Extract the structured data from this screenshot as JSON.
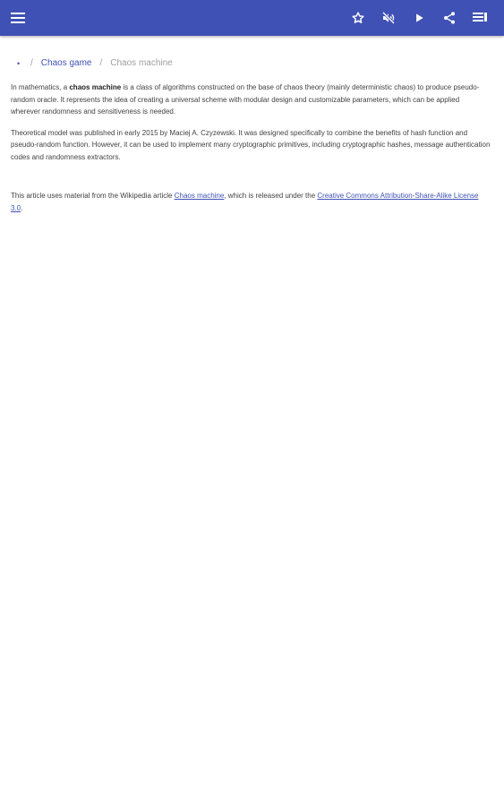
{
  "breadcrumb": {
    "home_symbol": "•",
    "separator": "/",
    "parent": "Chaos game",
    "current": "Chaos machine"
  },
  "article": {
    "p1_before": "In mathematics, a ",
    "p1_bold": "chaos machine",
    "p1_after": " is a class of algorithms constructed on the base of chaos theory (mainly deterministic chaos) to produce pseudo-random oracle. It represents the idea of creating a universal scheme with modular design and customizable parameters, which can be applied wherever randomness and sensitiveness is needed.",
    "p2": "Theoretical model was published in early 2015 by Maciej A. Czyzewski. It was designed specifically to combine the benefits of hash function and pseudo-random function. However, it can be used to implement many cryptographic primitives, including cryptographic hashes, message authentication codes and randomness extractors.",
    "license_before": "This article uses material from the Wikipedia article ",
    "license_link": "Chaos machine",
    "license_middle": ", which is released under the ",
    "license_cc_link": "Creative Commons Attribution-Share-Alike License 3.0",
    "license_after": "."
  },
  "colors": {
    "app_bar": "#3f51b5",
    "link": "#3f51b5",
    "text": "#424242"
  },
  "icons": {
    "menu": "hamburger-menu-icon",
    "star": "star-outline-icon",
    "mute": "volume-off-icon",
    "play": "play-icon",
    "share": "share-icon",
    "toc": "table-of-contents-icon"
  }
}
